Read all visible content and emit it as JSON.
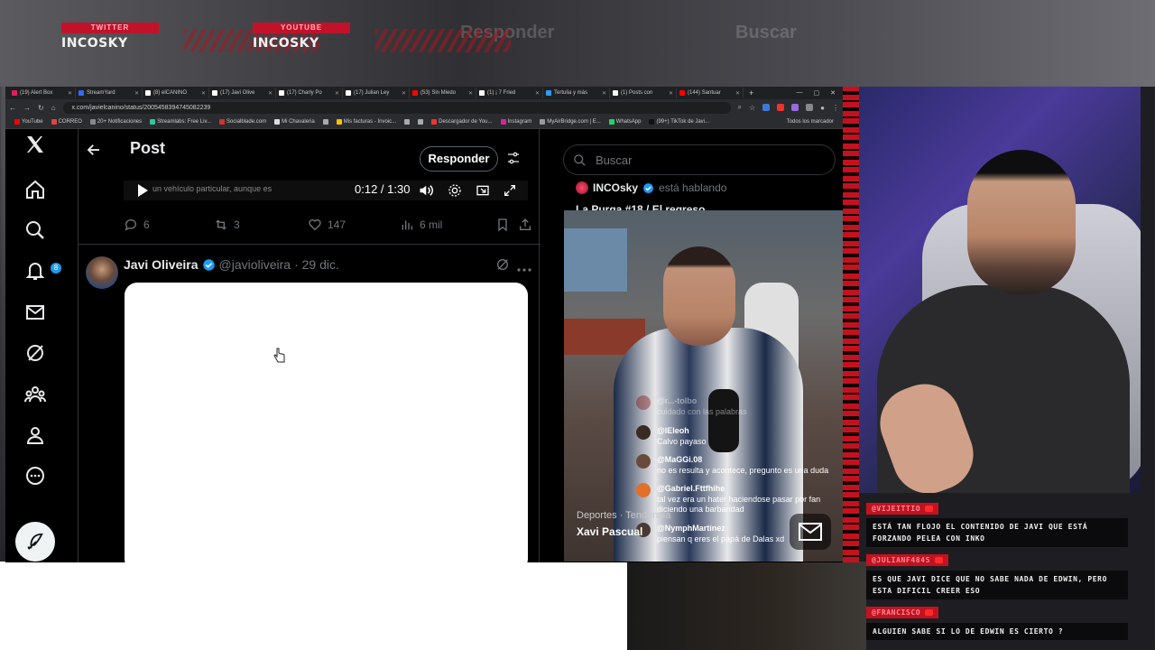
{
  "banners": [
    {
      "platform": "TWITTER",
      "handle": "INCOSKY"
    },
    {
      "platform": "YOUTUBE",
      "handle": "INCOSKY"
    }
  ],
  "bg_ghost": {
    "reply": "Responder",
    "search": "Buscar"
  },
  "browser": {
    "tabs": [
      {
        "label": "(19) Alert Box",
        "color": "#e01e5a"
      },
      {
        "label": "StreamYard",
        "color": "#2f6bff"
      },
      {
        "label": "(8) elCANINO",
        "color": "#ffffff"
      },
      {
        "label": "(17) Javi Olive",
        "color": "#ffffff"
      },
      {
        "label": "(17) Charly Po",
        "color": "#ffffff"
      },
      {
        "label": "(17) Julian Ley",
        "color": "#ffffff"
      },
      {
        "label": "(53) Sin Miedo",
        "color": "#ff0000"
      },
      {
        "label": "(1) ¡ 7 Fried",
        "color": "#ffffff"
      },
      {
        "label": "Tertulia y más",
        "color": "#2f9bff"
      },
      {
        "label": "(1) Posts con",
        "color": "#ffffff"
      },
      {
        "label": "(144) Santuar",
        "color": "#ff0000"
      }
    ],
    "url": "x.com/javielcanino/status/2005458394745082239",
    "bookmarks": [
      {
        "label": "YouTube",
        "color": "#ff0000"
      },
      {
        "label": "CORREO",
        "color": "#d44"
      },
      {
        "label": "20+ Notificaciones",
        "color": "#888"
      },
      {
        "label": "Streamlabs: Free Liv...",
        "color": "#31c3a2"
      },
      {
        "label": "Socialblade.com",
        "color": "#c33"
      },
      {
        "label": "Mi Chavaleria",
        "color": "#ddd"
      },
      {
        "label": "",
        "color": "#aaa"
      },
      {
        "label": "Mis facturas - Invoic...",
        "color": "#f5c400"
      },
      {
        "label": "",
        "color": "#aaa"
      },
      {
        "label": "",
        "color": "#aaa"
      },
      {
        "label": "Descargador de You...",
        "color": "#e33"
      },
      {
        "label": "Instagram",
        "color": "#d6249f"
      },
      {
        "label": "MyAirBridge.com | E...",
        "color": "#999"
      },
      {
        "label": "WhatsApp",
        "color": "#25d366"
      },
      {
        "label": "(99+) TikTok de Javi...",
        "color": "#111"
      }
    ],
    "bookmarks_more": "Todos los marcador"
  },
  "x": {
    "header_title": "Post",
    "reply_button": "Responder",
    "notif_count": "8",
    "video": {
      "overlay_text": "un vehículo particular, aunque es",
      "time": "0:12 / 1:30"
    },
    "actions": {
      "replies": "6",
      "reposts": "3",
      "likes": "147",
      "views": "6 mil"
    },
    "post": {
      "author": "Javi Oliveira",
      "handle": "@javioliveira",
      "date": "· 29 dic."
    },
    "search_placeholder": "Buscar",
    "live": {
      "name": "INCOsky",
      "status": "está hablando",
      "space_title": "La Purga #18 / El regreso"
    },
    "trend": {
      "label": "Deportes · Tendencia",
      "title": "Xavi Pascual"
    }
  },
  "overlay_chat": [
    {
      "user": "@r...-tolbo",
      "text": "cuidado con las palabras",
      "faded": true,
      "avatar": "#8a2020"
    },
    {
      "user": "@lEleoh",
      "text": "Calvo payaso",
      "faded": false,
      "avatar": "#3a2a24"
    },
    {
      "user": "@MaGGi.08",
      "text": "no es resulta y acontece, pregunto es una duda",
      "faded": false,
      "avatar": "#6a4a3a"
    },
    {
      "user": "@Gabriel.Fttfhihe",
      "text": "tal vez era un hater haciendose pasar por fan diciendo una barbaridad",
      "faded": false,
      "avatar": "#e0702a"
    },
    {
      "user": "@NymphMartínez",
      "text": "piensan q eres el papá de Dalas xd",
      "faded": false,
      "avatar": "#4a3a34"
    }
  ],
  "stream_chat": [
    {
      "user": "@VIJEITTIO",
      "message": "ESTÁ TAN FLOJO EL CONTENIDO DE JAVI QUE ESTÁ FORZANDO PELEA CON INKO"
    },
    {
      "user": "@JULIANF4845",
      "message": "ES QUE JAVI DICE QUE NO SABE NADA DE EDWIN, PERO ESTA DIFICIL CREER ESO"
    },
    {
      "user": "@FRANCISCO",
      "message": "ALGUIEN SABE SI LO DE EDWIN ES CIERTO ?"
    }
  ],
  "colors": {
    "x_blue": "#1d9bf0",
    "stream_red": "#c3121f",
    "x_bg": "#000000",
    "x_text": "#e7e9ea",
    "x_muted": "#71767b"
  }
}
